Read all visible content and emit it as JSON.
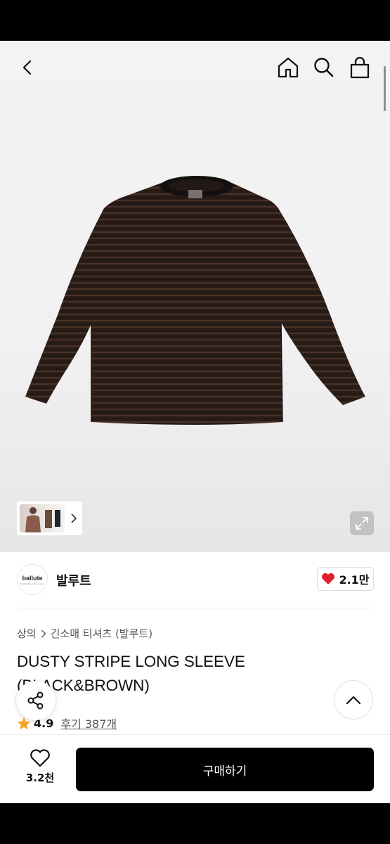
{
  "icons": {
    "back": "chevron-left-icon",
    "home": "home-icon",
    "search": "search-icon",
    "cart": "shopping-bag-icon",
    "expand": "expand-icon",
    "like": "heart-icon",
    "share": "share-icon",
    "top": "chevron-up-icon",
    "wish": "heart-outline-icon"
  },
  "brand": {
    "logo_text": "ballute",
    "logo_subtext": "Sustainable, easy to wear",
    "name": "발루트",
    "likes": "2.1만"
  },
  "breadcrumb": [
    "상의",
    "긴소매 티셔츠 (발루트)"
  ],
  "product": {
    "title": "DUSTY STRIPE LONG SLEEVE (BLACK&BROWN)",
    "rating": "4.9",
    "reviews": "후기 387개"
  },
  "bottom_bar": {
    "wish_count": "3.2천",
    "buy_label": "구매하기"
  },
  "colors": {
    "accent": "#000000",
    "like_heart": "#e0202a",
    "star": "#f5a623"
  }
}
